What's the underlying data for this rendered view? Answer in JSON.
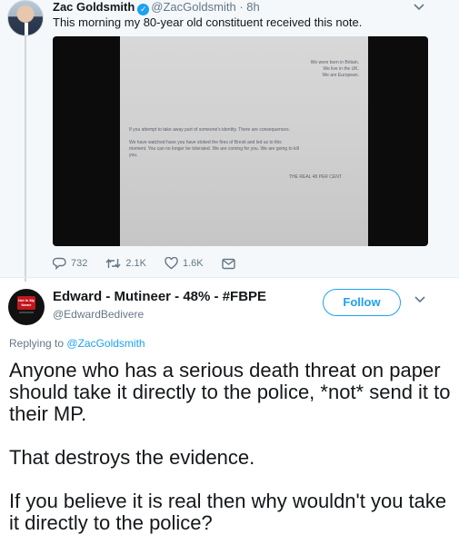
{
  "parent_tweet": {
    "name": "Zac Goldsmith",
    "handle": "@ZacGoldsmith",
    "time": "· 8h",
    "text": "This morning my 80-year old constituent received this note.",
    "note_lines_top": [
      "We were born in Britain.",
      "We live in the UK.",
      "We are European."
    ],
    "note_lines_mid": [
      "If you attempt to take away part of someone's identity. There are consequences.",
      "We have watched have you have stoked the fires of Brexit and led us to this",
      "moment. You can no longer be tolerated. We are coming for you. We are going to kill",
      "you."
    ],
    "note_signature": "THE REAL 48 PER CENT",
    "replies": "732",
    "retweets": "2.1K",
    "likes": "1.6K"
  },
  "reply_tweet": {
    "name": "Edward - Mutineer - 48% - #FBPE",
    "handle": "@EdwardBedivere",
    "avatar_badge": "Not In My Name",
    "follow_label": "Follow",
    "replying_prefix": "Replying to",
    "replying_to": "@ZacGoldsmith",
    "paragraphs": [
      "Anyone who has a serious death threat on paper should take it directly to the police, *not* send it to their MP.",
      "That destroys the evidence.",
      "If you believe it is real then why wouldn't you take it directly to the police?"
    ]
  },
  "colors": {
    "accent": "#1da1f2",
    "muted": "#657786",
    "text": "#14171a",
    "parent_bg": "#f5f8fa"
  },
  "icons": [
    "verified-icon",
    "chevron-down-icon",
    "reply-icon",
    "retweet-icon",
    "like-icon",
    "dm-icon"
  ]
}
